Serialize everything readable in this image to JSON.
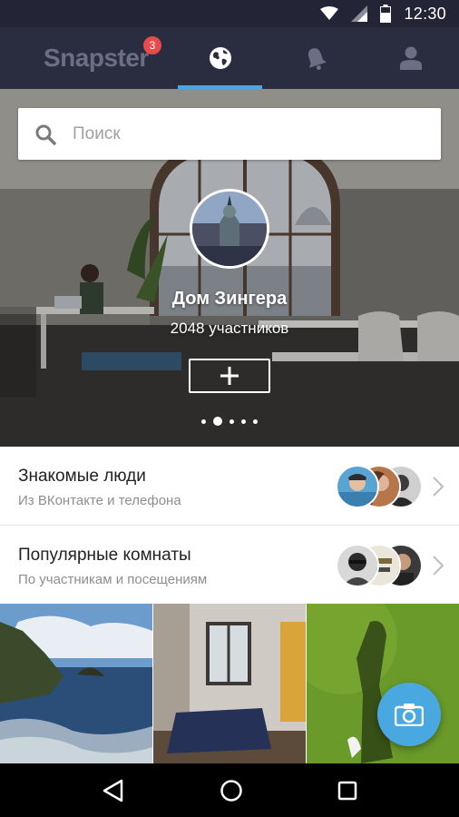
{
  "status_bar": {
    "time": "12:30"
  },
  "nav": {
    "logo": "Snapster",
    "badge_count": "3",
    "tabs": [
      "tab-logo",
      "tab-explore",
      "tab-notifications",
      "tab-profile"
    ],
    "accent_color": "#4aa8e0"
  },
  "search": {
    "placeholder": "Поиск"
  },
  "room": {
    "name": "Дом Зингера",
    "members": "2048 участников",
    "pager_count": 5,
    "pager_active": 1
  },
  "rows": [
    {
      "title": "Знакомые люди",
      "subtitle": "Из ВКонтакте и телефона"
    },
    {
      "title": "Популярные комнаты",
      "subtitle": "По участникам и посещениям"
    }
  ],
  "grid": {
    "tiles": [
      "sea-coast-photo",
      "bedroom-photo",
      "grass-shadow-photo"
    ]
  },
  "fab": {
    "icon": "camera-icon"
  },
  "system_nav": {
    "icons": [
      "back-icon",
      "home-icon",
      "recents-icon"
    ]
  }
}
